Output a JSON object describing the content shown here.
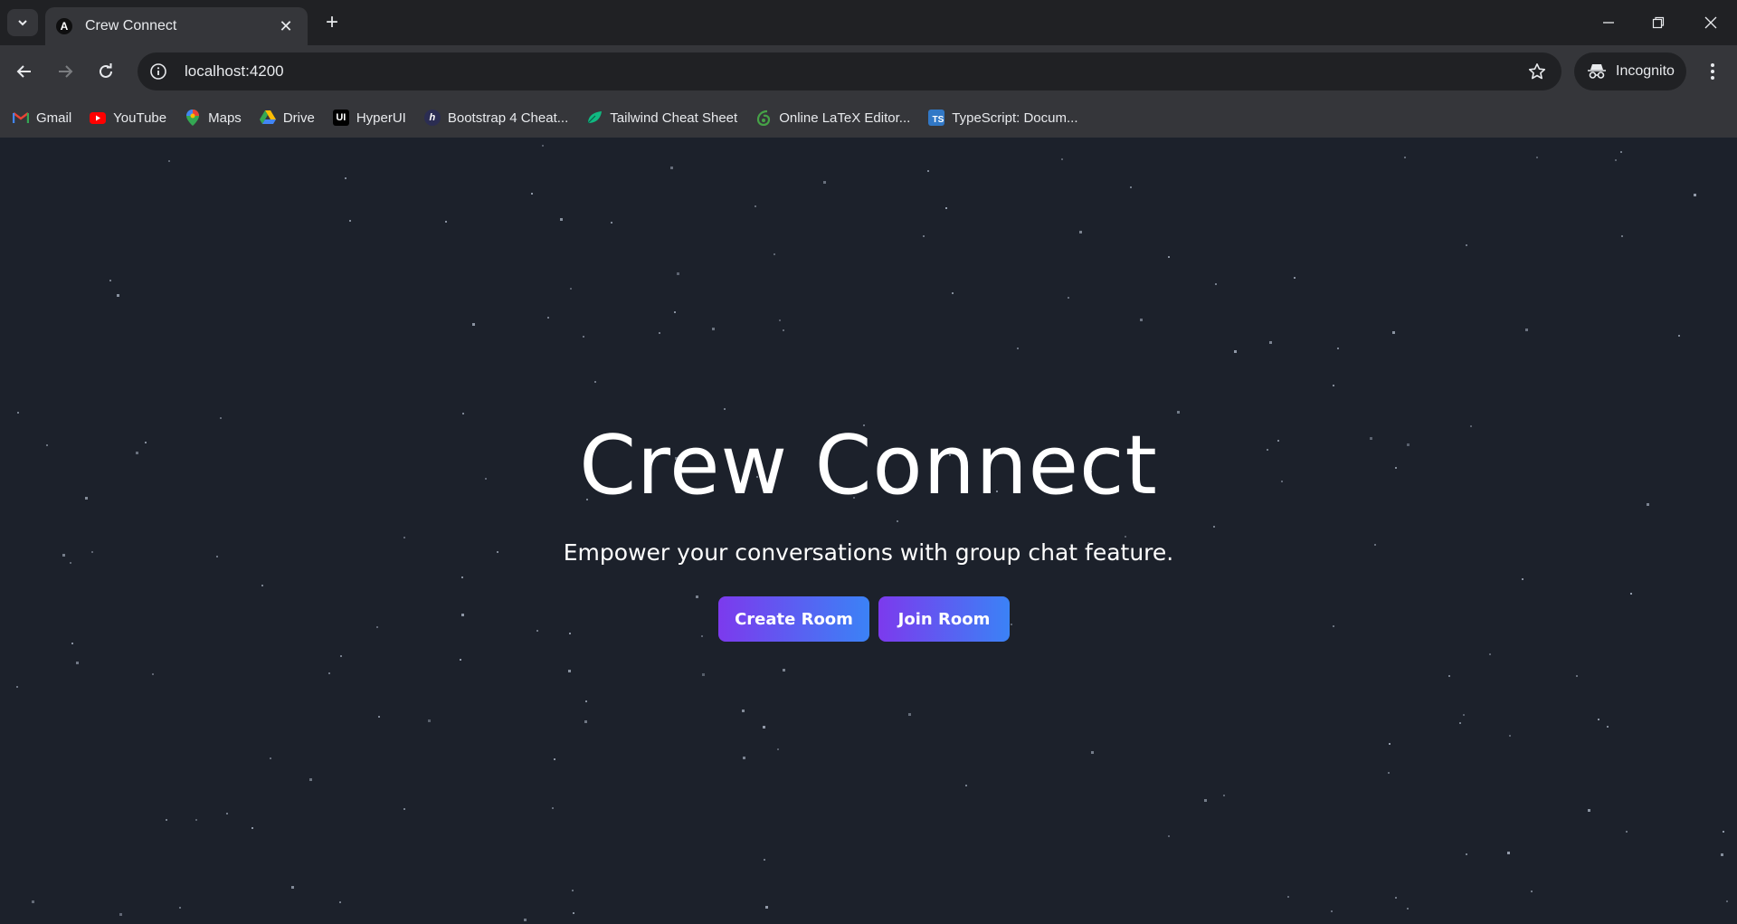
{
  "browser": {
    "tab_title": "Crew Connect",
    "tab_favicon_letter": "A",
    "url": "localhost:4200",
    "incognito_label": "Incognito"
  },
  "bookmarks": [
    {
      "label": "Gmail",
      "icon": "gmail-icon"
    },
    {
      "label": "YouTube",
      "icon": "youtube-icon"
    },
    {
      "label": "Maps",
      "icon": "maps-icon"
    },
    {
      "label": "Drive",
      "icon": "drive-icon"
    },
    {
      "label": "HyperUI",
      "icon": "hyperui-icon",
      "icon_text": "UI"
    },
    {
      "label": "Bootstrap 4 Cheat...",
      "icon": "bootstrap-icon",
      "icon_text": "h"
    },
    {
      "label": "Tailwind Cheat Sheet",
      "icon": "tailwind-icon"
    },
    {
      "label": "Online LaTeX Editor...",
      "icon": "overleaf-icon"
    },
    {
      "label": "TypeScript: Docum...",
      "icon": "typescript-icon",
      "icon_text": "TS"
    }
  ],
  "hero": {
    "title": "Crew Connect",
    "subtitle": "Empower your conversations with group chat feature.",
    "create_label": "Create Room",
    "join_label": "Join Room"
  },
  "colors": {
    "page_bg": "#1c212b",
    "button_gradient_start": "#7c3aed",
    "button_gradient_end": "#3b82f6"
  }
}
